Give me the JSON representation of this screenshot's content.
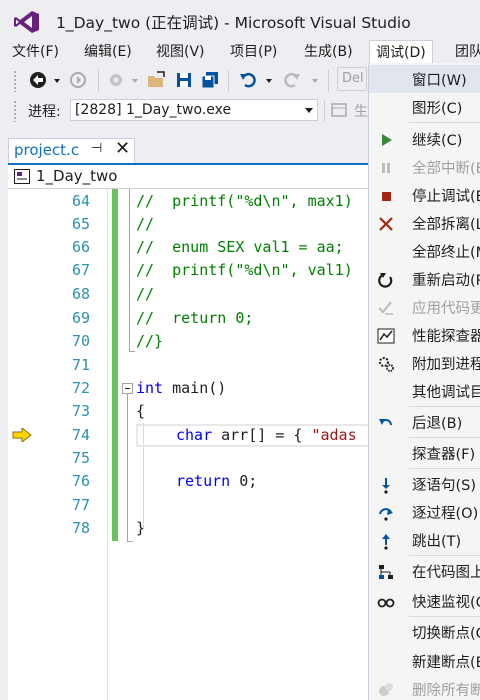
{
  "window": {
    "title": "1_Day_two (正在调试) - Microsoft Visual Studio"
  },
  "menubar": {
    "items": [
      "文件(F)",
      "编辑(E)",
      "视图(V)",
      "项目(P)",
      "生成(B)",
      "调试(D)",
      "团队"
    ]
  },
  "toolbar": {
    "process_label": "进程:",
    "process_value": "[2828] 1_Day_two.exe",
    "del_label": "Del",
    "thread_label": "生"
  },
  "editor_tab": {
    "filename": "project.c",
    "nav_project": "1_Day_two"
  },
  "code": {
    "lines": [
      {
        "n": "64",
        "text": "//  printf(\"%d\\n\", max1)"
      },
      {
        "n": "65",
        "text": "//"
      },
      {
        "n": "66",
        "text": "//  enum SEX val1 = aa;"
      },
      {
        "n": "67",
        "text": "//  printf(\"%d\\n\", val1)"
      },
      {
        "n": "68",
        "text": "//"
      },
      {
        "n": "69",
        "text": "//  return 0;"
      },
      {
        "n": "70",
        "text": "//}"
      },
      {
        "n": "71",
        "text": ""
      },
      {
        "n": "72",
        "kw": "int",
        "rest": " main()"
      },
      {
        "n": "73",
        "text": "{"
      },
      {
        "n": "74",
        "kw": "char",
        "rest": " arr[] = { ",
        "str": "\"adas"
      },
      {
        "n": "75",
        "text": ""
      },
      {
        "n": "76",
        "kw": "return",
        "rest": " 0;"
      },
      {
        "n": "77",
        "text": ""
      },
      {
        "n": "78",
        "text": "}"
      }
    ]
  },
  "debug_menu": {
    "items": [
      {
        "label": "窗口(W)",
        "icon": "none",
        "disabled": false,
        "highlight": true
      },
      {
        "label": "图形(C)",
        "icon": "none",
        "disabled": false
      },
      {
        "label": "继续(C)",
        "icon": "play-icon",
        "disabled": false
      },
      {
        "label": "全部中断(B",
        "icon": "pause-icon",
        "disabled": true
      },
      {
        "label": "停止调试(E",
        "icon": "stop-icon",
        "disabled": false
      },
      {
        "label": "全部拆离(L",
        "icon": "detach-icon",
        "disabled": false
      },
      {
        "label": "全部终止(M",
        "icon": "none",
        "disabled": false
      },
      {
        "label": "重新启动(R",
        "icon": "restart-icon",
        "disabled": false
      },
      {
        "label": "应用代码更",
        "icon": "apply-code-icon",
        "disabled": true
      },
      {
        "label": "性能探查器",
        "icon": "profiler-icon",
        "disabled": false
      },
      {
        "label": "附加到进程",
        "icon": "attach-icon",
        "disabled": false
      },
      {
        "label": "其他调试目",
        "icon": "none",
        "disabled": false
      },
      {
        "label": "后退(B)",
        "icon": "step-back-icon",
        "disabled": false
      },
      {
        "label": "探查器(F)",
        "icon": "none",
        "disabled": false
      },
      {
        "label": "逐语句(S)",
        "icon": "step-into-icon",
        "disabled": false
      },
      {
        "label": "逐过程(O)",
        "icon": "step-over-icon",
        "disabled": false
      },
      {
        "label": "跳出(T)",
        "icon": "step-out-icon",
        "disabled": false
      },
      {
        "label": "在代码图上",
        "icon": "code-map-icon",
        "disabled": false
      },
      {
        "label": "快速监视(Q",
        "icon": "quick-watch-icon",
        "disabled": false
      },
      {
        "label": "切换断点(G",
        "icon": "none",
        "disabled": false
      },
      {
        "label": "新建断点(B",
        "icon": "none",
        "disabled": false
      },
      {
        "label": "删除所有断",
        "icon": "delete-breakpoints-icon",
        "disabled": true
      }
    ]
  },
  "colors": {
    "accent": "#0e70c0",
    "comment": "#008000",
    "keyword": "#0000ff",
    "string": "#a31515",
    "line_number": "#2b91af",
    "change_bar": "#68c25d"
  }
}
